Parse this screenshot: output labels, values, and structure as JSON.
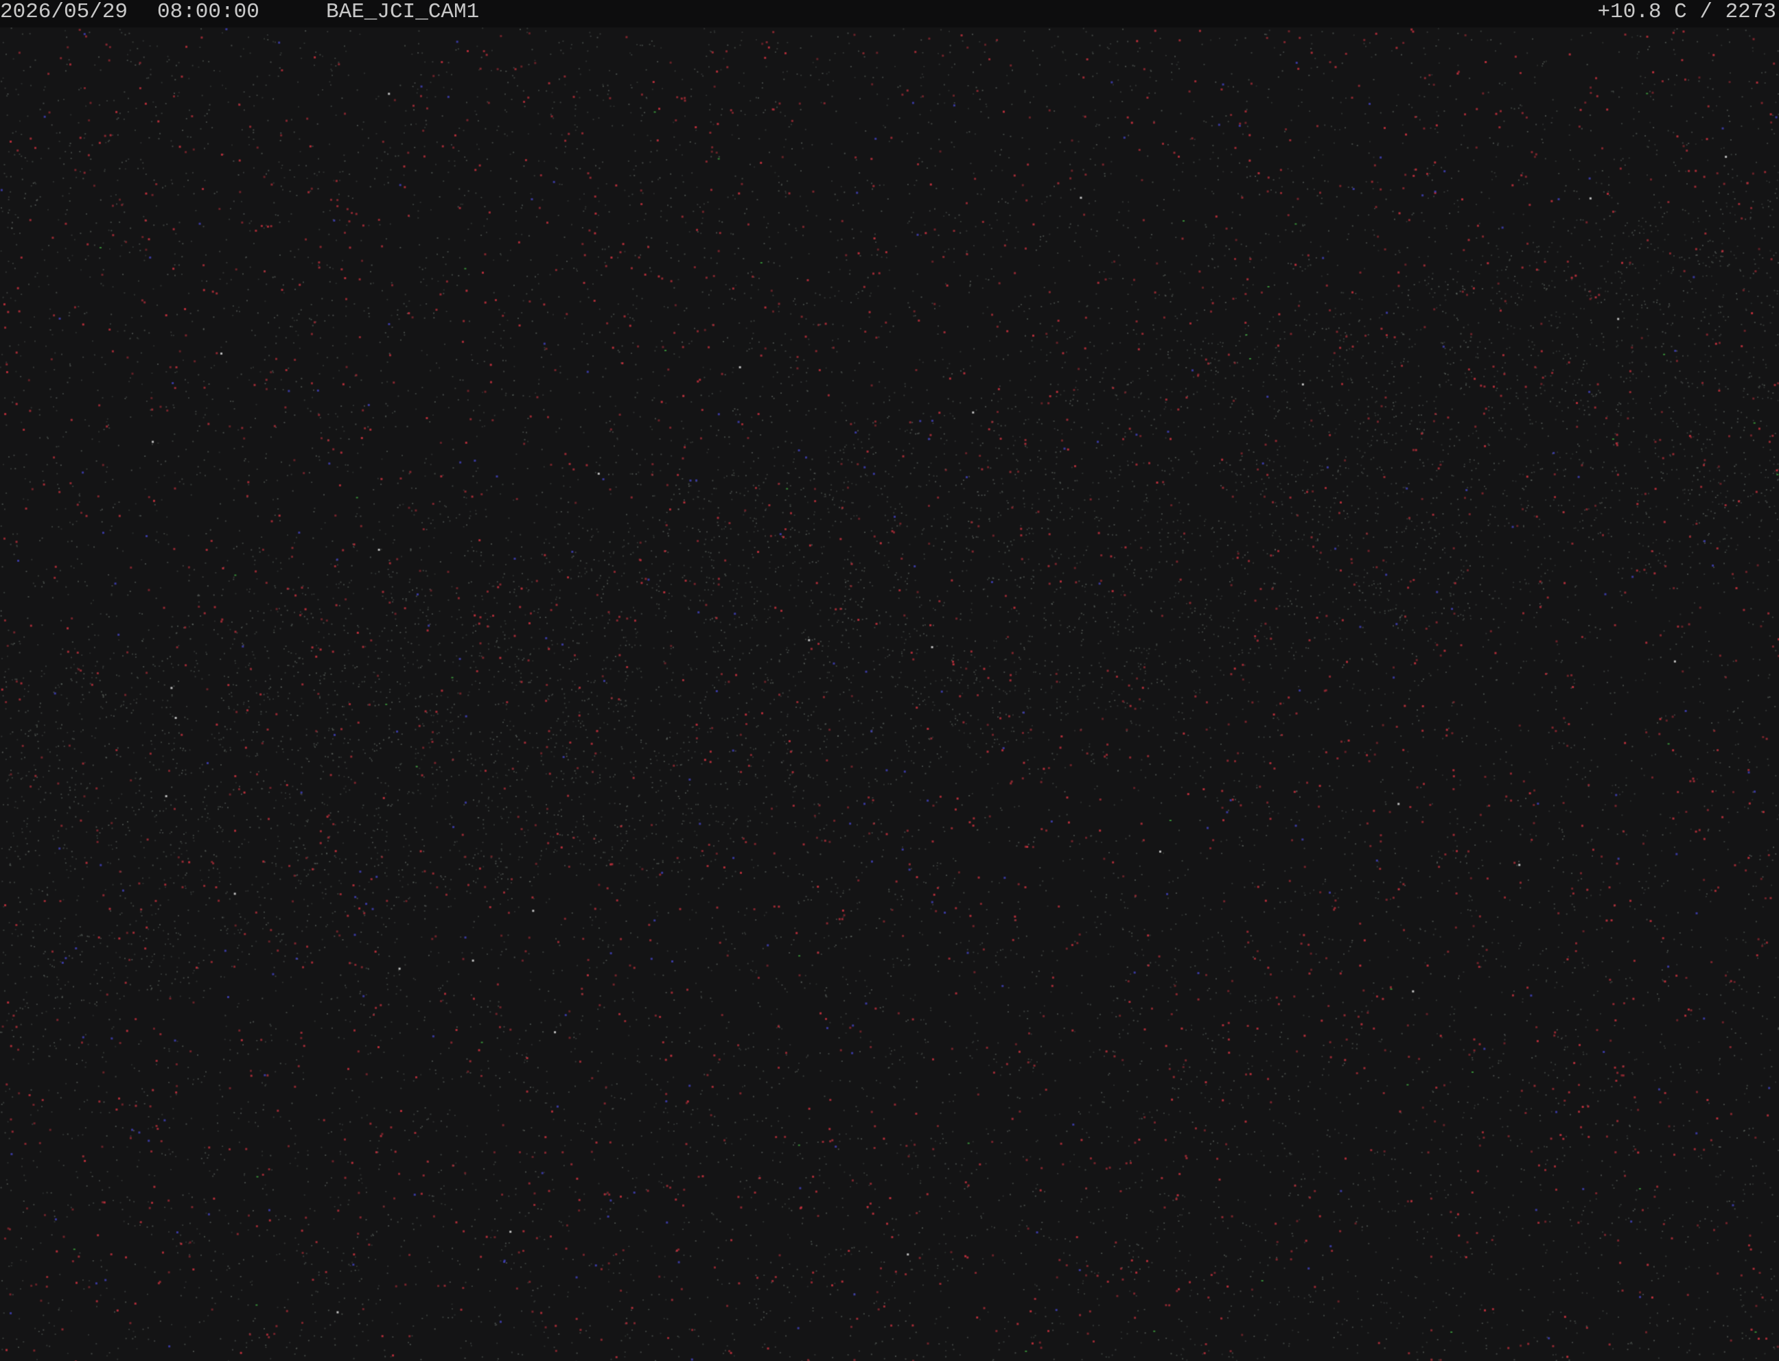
{
  "overlay": {
    "date": "2026/05/29",
    "time": "08:00:00",
    "camera_id": "BAE_JCI_CAM1",
    "sensor_readout": "+10.8 C / 2273"
  },
  "colors": {
    "background": "#141415",
    "overlay_bar": "#0d0d0e",
    "overlay_text": "#c9c9c9",
    "star_red": "#b8323c",
    "star_grey": "#5a5f5c",
    "star_blue": "#3a3ab8",
    "star_green": "#40c040"
  }
}
